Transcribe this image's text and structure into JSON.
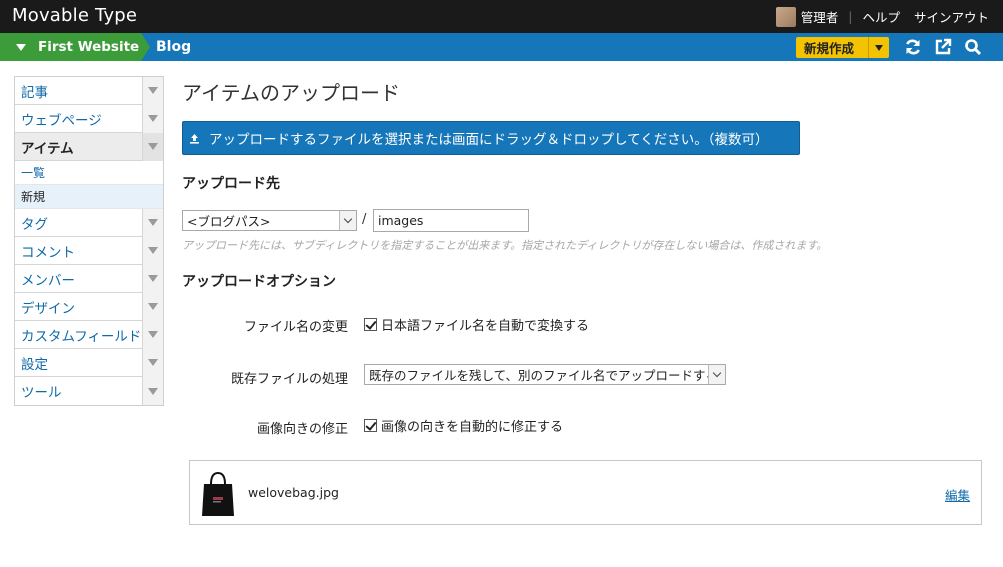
{
  "app": {
    "title": "Movable Type"
  },
  "user": {
    "name": "管理者",
    "help": "ヘルプ",
    "signout": "サインアウト"
  },
  "context": {
    "website": "First Website",
    "blog": "Blog",
    "new_label": "新規作成"
  },
  "sidebar": {
    "items": [
      {
        "label": "記事"
      },
      {
        "label": "ウェブページ"
      },
      {
        "label": "アイテム"
      },
      {
        "label": "タグ"
      },
      {
        "label": "コメント"
      },
      {
        "label": "メンバー"
      },
      {
        "label": "デザイン"
      },
      {
        "label": "カスタムフィールド"
      },
      {
        "label": "設定"
      },
      {
        "label": "ツール"
      }
    ],
    "sub": [
      {
        "label": "一覧"
      },
      {
        "label": "新規"
      }
    ]
  },
  "main": {
    "title": "アイテムのアップロード",
    "upload_button": "アップロードするファイルを選択または画面にドラッグ＆ドロップしてください。（複数可）",
    "dest_heading": "アップロード先",
    "dest_select": "<ブログパス>",
    "dest_slash": "/",
    "dest_dir": "images",
    "dest_hint": "アップロード先には、サブディレクトリを指定することが出来ます。指定されたディレクトリが存在しない場合は、作成されます。",
    "options_heading": "アップロードオプション",
    "opt_filename_label": "ファイル名の変更",
    "opt_filename_check": "日本語ファイル名を自動で変換する",
    "opt_existing_label": "既存ファイルの処理",
    "opt_existing_select": "既存のファイルを残して、別のファイル名でアップロードする",
    "opt_orient_label": "画像向きの修正",
    "opt_orient_check": "画像の向きを自動的に修正する"
  },
  "file": {
    "name": "welovebag.jpg",
    "edit": "編集"
  },
  "colors": {
    "topbar": "#1a1a1a",
    "ctxbar": "#1576b9",
    "website": "#3d9c3a",
    "new_button": "#f3c200",
    "link": "#0f6aa9"
  }
}
